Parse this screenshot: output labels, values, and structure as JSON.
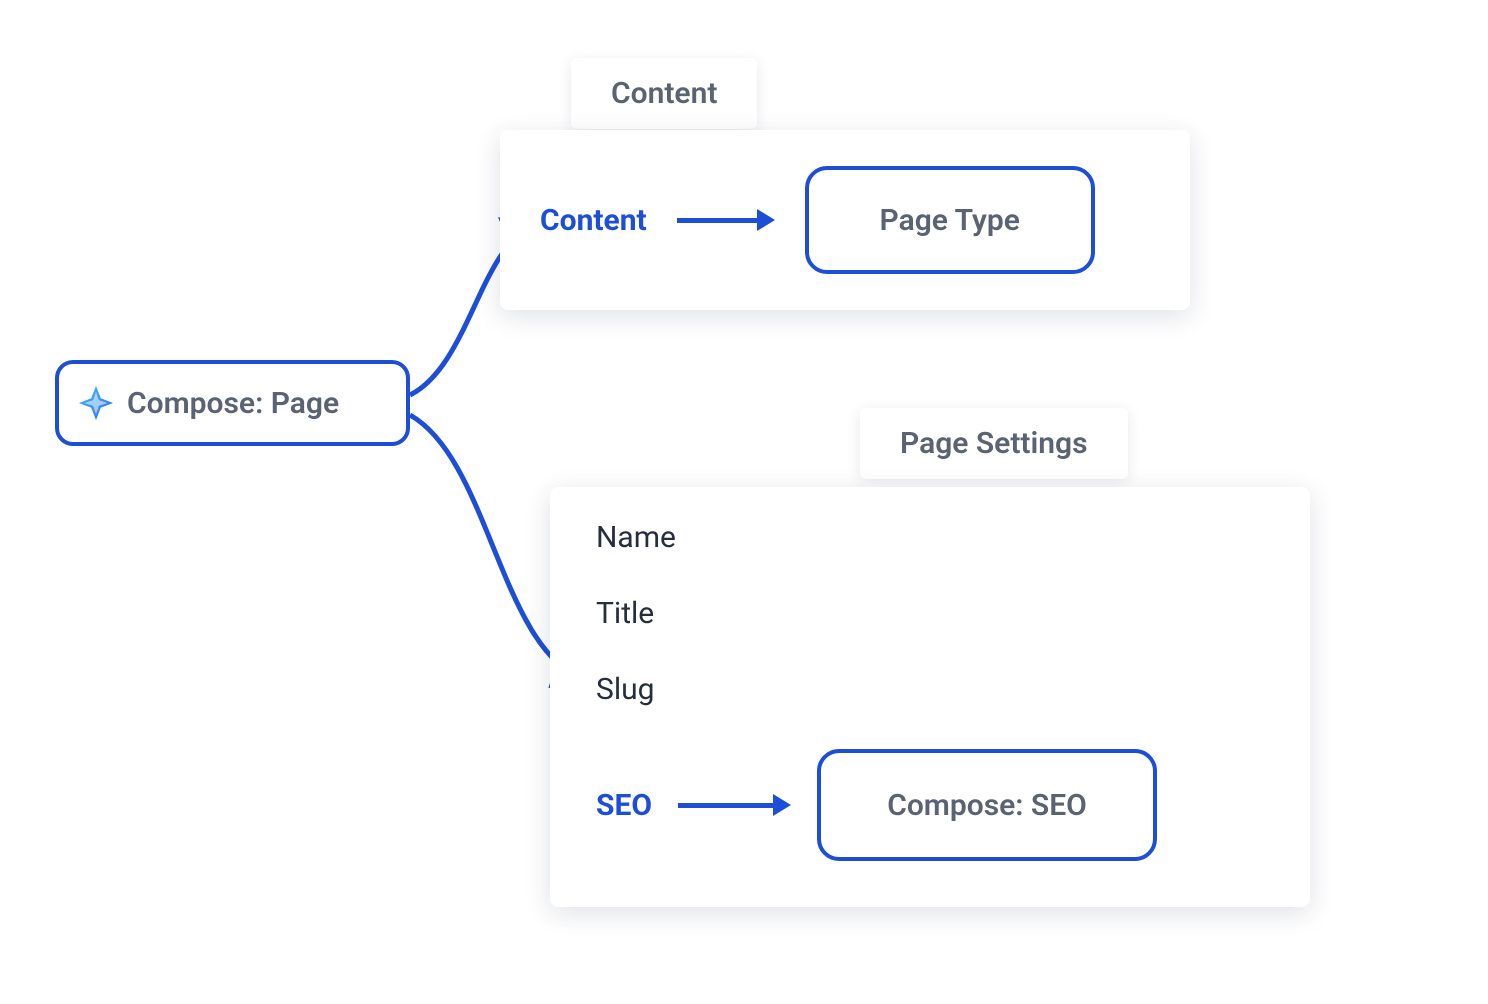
{
  "colors": {
    "brandBlue": "#1d4ed8",
    "textGray": "#5a6273",
    "textDark": "#262d3d"
  },
  "root": {
    "label": "Compose: Page",
    "icon": "sparkle-icon"
  },
  "branches": {
    "content": {
      "tabLabel": "Content",
      "fieldLabel": "Content",
      "reference": "Page Type"
    },
    "settings": {
      "tabLabel": "Page Settings",
      "fields": {
        "name": "Name",
        "title": "Title",
        "slug": "Slug",
        "seoLabel": "SEO",
        "seoReference": "Compose: SEO"
      }
    }
  }
}
